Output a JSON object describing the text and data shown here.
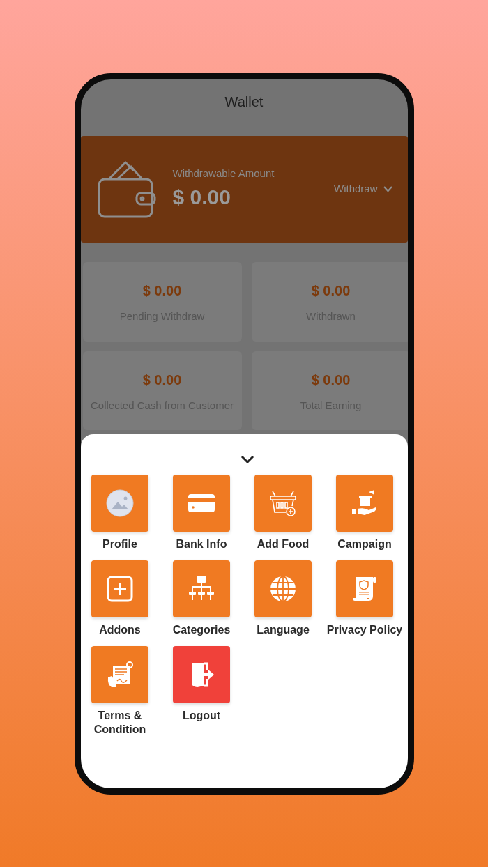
{
  "header": {
    "title": "Wallet"
  },
  "balance": {
    "label": "Withdrawable Amount",
    "amount": "$ 0.00",
    "action": "Withdraw"
  },
  "stats": [
    {
      "amount": "$ 0.00",
      "label": "Pending Withdraw"
    },
    {
      "amount": "$ 0.00",
      "label": "Withdrawn"
    },
    {
      "amount": "$ 0.00",
      "label": "Collected Cash from Customer"
    },
    {
      "amount": "$ 0.00",
      "label": "Total Earning"
    }
  ],
  "menu": [
    {
      "label": "Profile",
      "color": "#f07a22"
    },
    {
      "label": "Bank Info",
      "color": "#f07a22"
    },
    {
      "label": "Add Food",
      "color": "#f07a22"
    },
    {
      "label": "Campaign",
      "color": "#f07a22"
    },
    {
      "label": "Addons",
      "color": "#f07a22"
    },
    {
      "label": "Categories",
      "color": "#f07a22"
    },
    {
      "label": "Language",
      "color": "#f07a22"
    },
    {
      "label": "Privacy Policy",
      "color": "#f07a22"
    },
    {
      "label": "Terms & Condition",
      "color": "#f07a22"
    },
    {
      "label": "Logout",
      "color": "#f0413a"
    }
  ]
}
